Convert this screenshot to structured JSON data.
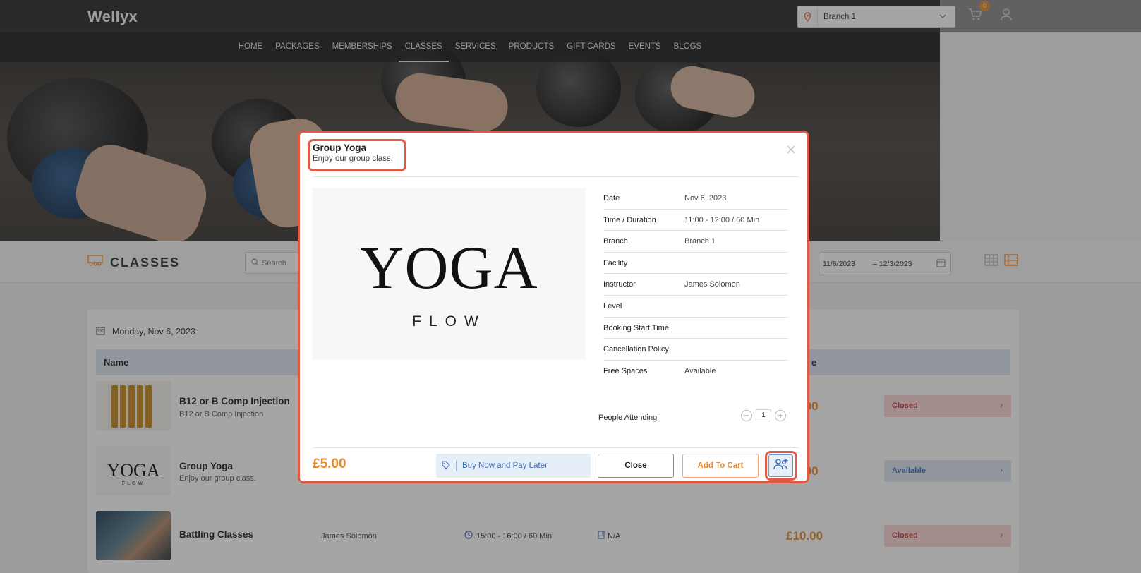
{
  "header": {
    "logo": "Wellyx",
    "nav": [
      "HOME",
      "PACKAGES",
      "MEMBERSHIPS",
      "CLASSES",
      "SERVICES",
      "PRODUCTS",
      "GIFT CARDS",
      "EVENTS",
      "BLOGS"
    ],
    "active_nav": "CLASSES",
    "branch_select": "Branch 1",
    "cart_count": "0"
  },
  "classes_bar": {
    "title": "CLASSES",
    "search_placeholder": "Search",
    "date_from": "11/6/2023",
    "date_to": "– 12/3/2023"
  },
  "list": {
    "day": "Monday, Nov 6, 2023",
    "col_name": "Name",
    "col_price_partial": "e",
    "rows": [
      {
        "name": "B12 or B Comp Injection",
        "sub": "B12 or B Comp Injection",
        "price_partial": ".00",
        "status": "Closed"
      },
      {
        "name": "Group Yoga",
        "sub": "Enjoy our group class.",
        "price_partial": ".00",
        "status": "Available",
        "thumb_text": "YOGA",
        "thumb_sub": "FLOW"
      },
      {
        "name": "Battling Classes",
        "instructor": "James Solomon",
        "time": "15:00 - 16:00 / 60 Min",
        "facility": "N/A",
        "price": "£10.00",
        "status": "Closed"
      }
    ]
  },
  "modal": {
    "title": "Group Yoga",
    "subtitle": "Enjoy our group class.",
    "image_text": "YOGA",
    "image_sub": "FLOW",
    "details": [
      {
        "label": "Date",
        "value": "Nov 6, 2023"
      },
      {
        "label": "Time / Duration",
        "value": "11:00 - 12:00 / 60 Min"
      },
      {
        "label": "Branch",
        "value": "Branch 1"
      },
      {
        "label": "Facility",
        "value": ""
      },
      {
        "label": "Instructor",
        "value": "James Solomon"
      },
      {
        "label": "Level",
        "value": ""
      },
      {
        "label": "Booking Start Time",
        "value": ""
      },
      {
        "label": "Cancellation Policy",
        "value": ""
      },
      {
        "label": "Free Spaces",
        "value": "Available"
      }
    ],
    "people_label": "People Attending",
    "people_count": "1",
    "price": "£5.00",
    "bnpl_label": "Buy Now and Pay Later",
    "close_label": "Close",
    "add_to_cart_label": "Add To Cart"
  },
  "colors": {
    "accent": "#e98a2c",
    "highlight": "#e05a45",
    "blue": "#3c6cb8"
  }
}
